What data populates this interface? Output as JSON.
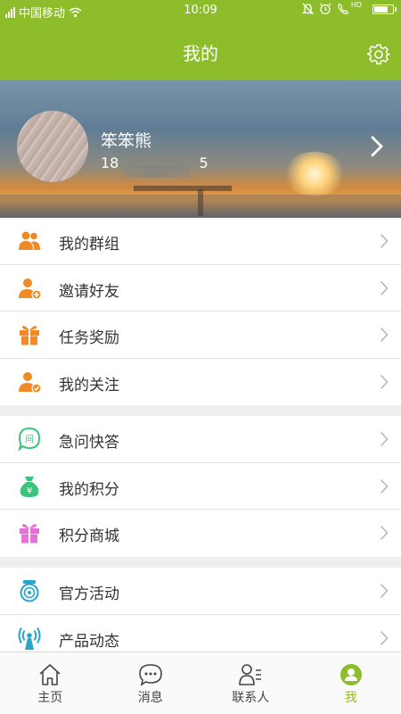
{
  "status_bar": {
    "carrier": "中国移动",
    "time": "10:09",
    "network_badge": "HD"
  },
  "header": {
    "title": "我的",
    "settings_icon": "gear-icon"
  },
  "profile": {
    "name": "笨笨熊",
    "phone_prefix": "18",
    "phone_suffix": "5",
    "chevron_icon": "chevron-right-icon"
  },
  "menu_groups": [
    [
      {
        "label": "我的群组",
        "icon": "group-icon",
        "color": "#f08a24"
      },
      {
        "label": "邀请好友",
        "icon": "invite-friend-icon",
        "color": "#f08a24"
      },
      {
        "label": "任务奖励",
        "icon": "gift-icon",
        "color": "#f08a24"
      },
      {
        "label": "我的关注",
        "icon": "follow-icon",
        "color": "#f08a24"
      }
    ],
    [
      {
        "label": "急问快答",
        "icon": "quick-question-icon",
        "color": "#3cc47c"
      },
      {
        "label": "我的积分",
        "icon": "points-bag-icon",
        "color": "#3cc47c"
      },
      {
        "label": "积分商城",
        "icon": "points-mall-icon",
        "color": "#e572d9"
      }
    ],
    [
      {
        "label": "官方活动",
        "icon": "official-activity-icon",
        "color": "#27a6c9"
      },
      {
        "label": "产品动态",
        "icon": "product-news-icon",
        "color": "#27a6c9"
      }
    ]
  ],
  "tabs": [
    {
      "label": "主页",
      "icon": "home-icon",
      "active": false
    },
    {
      "label": "消息",
      "icon": "message-icon",
      "active": false
    },
    {
      "label": "联系人",
      "icon": "contacts-icon",
      "active": false
    },
    {
      "label": "我",
      "icon": "me-icon",
      "active": true
    }
  ],
  "colors": {
    "brand": "#8dbd2a",
    "orange": "#f08a24",
    "green": "#3cc47c",
    "pink": "#e572d9",
    "teal": "#27a6c9"
  }
}
